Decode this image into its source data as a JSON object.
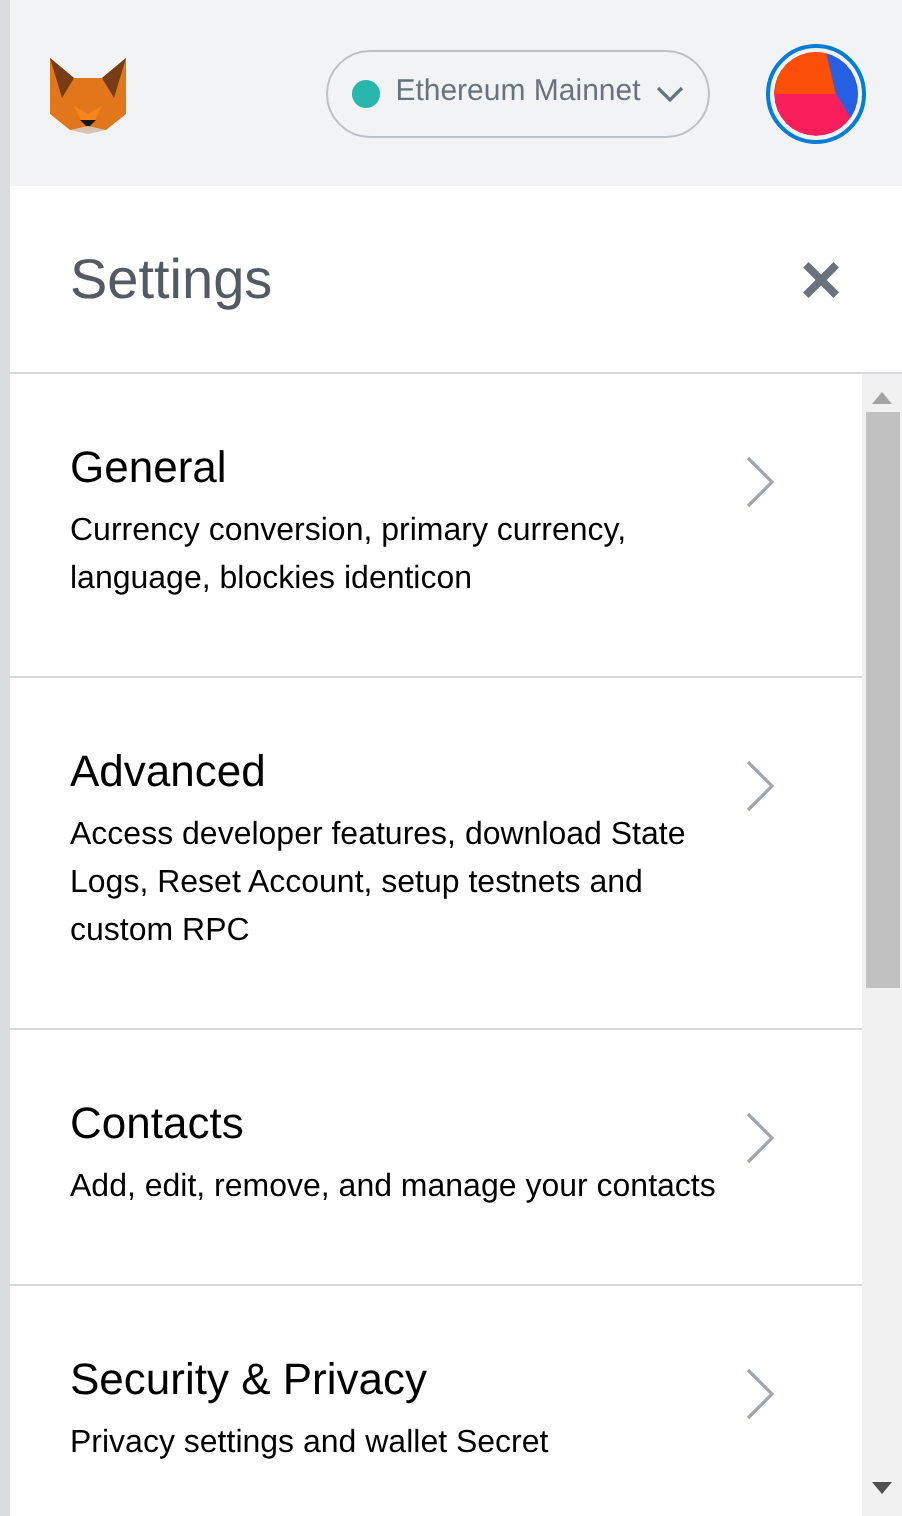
{
  "header": {
    "network": {
      "label": "Ethereum Mainnet",
      "color": "#29b6af"
    }
  },
  "settings": {
    "title": "Settings",
    "close": "×",
    "items": [
      {
        "title": "General",
        "description": "Currency conversion, primary currency, language, blockies identicon"
      },
      {
        "title": "Advanced",
        "description": "Access developer features, download State Logs, Reset Account, setup testnets and custom RPC"
      },
      {
        "title": "Contacts",
        "description": "Add, edit, remove, and manage your contacts"
      },
      {
        "title": "Security & Privacy",
        "description": "Privacy settings and wallet Secret"
      }
    ]
  }
}
